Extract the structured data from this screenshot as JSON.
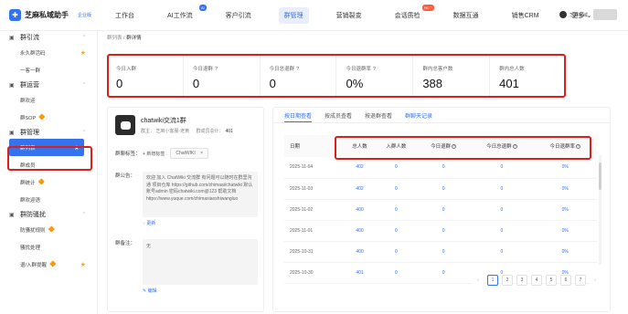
{
  "app": {
    "name": "芝麻私域助手",
    "version": "企业版",
    "logo_glyph": "✚"
  },
  "nav": [
    {
      "label": "工作台"
    },
    {
      "label": "AI工作流",
      "badge": "AI"
    },
    {
      "label": "客户引流"
    },
    {
      "label": "群管理",
      "active": true
    },
    {
      "label": "营销裂变"
    },
    {
      "label": "会话质检",
      "badge": "HOT"
    },
    {
      "label": "数据互通"
    },
    {
      "label": "销售CRM"
    },
    {
      "label": "更多"
    }
  ],
  "user": {
    "name": "芝麻私域"
  },
  "sidebar": {
    "groups": [
      {
        "label": "群引流",
        "icon": "link-icon",
        "items": [
          {
            "label": "永久群活码",
            "star": true
          },
          {
            "label": "一客一群"
          }
        ]
      },
      {
        "label": "群运营",
        "icon": "chat-icon",
        "items": [
          {
            "label": "群欢迎"
          },
          {
            "label": "群SOP",
            "premium": true
          }
        ]
      },
      {
        "label": "群管理",
        "icon": "group-icon",
        "items": [
          {
            "label": "群列表",
            "active": true,
            "star": true
          },
          {
            "label": "群成员"
          },
          {
            "label": "群统计",
            "premium": true
          },
          {
            "label": "群欢迎语"
          }
        ]
      },
      {
        "label": "群防骚扰",
        "icon": "shield-icon",
        "items": [
          {
            "label": "防骚扰规则",
            "premium": true
          },
          {
            "label": "骚扰处理"
          },
          {
            "label": "退/入群提醒",
            "premium": true,
            "star": true
          }
        ]
      }
    ]
  },
  "breadcrumb": {
    "parent": "群列表",
    "sep": "/",
    "current": "群详情"
  },
  "stats": [
    {
      "label": "今日入群",
      "value": "0"
    },
    {
      "label": "今日退群",
      "value": "0",
      "help": true
    },
    {
      "label": "今日总退群",
      "value": "0",
      "help": true
    },
    {
      "label": "今日退群率",
      "value": "0%",
      "help": true
    },
    {
      "label": "群内总客户数",
      "value": "388"
    },
    {
      "label": "群内总人数",
      "value": "401"
    }
  ],
  "group": {
    "name": "chatwiki交流1群",
    "owner_label": "群主：",
    "owner": "芝麻小客服-老黄",
    "member_label": "群成员总计：",
    "member_count": "401",
    "tag_label": "群聊标签：",
    "add_tag": "新增标签",
    "tags": [
      "ChatWIKI"
    ],
    "notice_label": "群公告：",
    "notice": "欢迎 加入 ChatWiki 交流群 有问题可以随时在群里沟通 项目仓库 https://github.com/zhimaai/chatwiki 默认账号admin 密码chatwiki.com@123 帮助文档 https://www.yuque.com/zhimaxiaoshiwangluo",
    "refresh": "更新",
    "remark_label": "群备注：",
    "remark": "无",
    "edit": "编辑"
  },
  "panel": {
    "tabs": [
      {
        "label": "按日期查看",
        "active": true
      },
      {
        "label": "按成员查看"
      },
      {
        "label": "按退群查看"
      },
      {
        "label": "群聊天记录",
        "link": true
      }
    ],
    "columns": [
      {
        "label": "日期"
      },
      {
        "label": "总人数"
      },
      {
        "label": "入群人数"
      },
      {
        "label": "今日退群",
        "help": true
      },
      {
        "label": "今日总退群",
        "help": true
      },
      {
        "label": "今日退群率",
        "help": true
      }
    ],
    "rows": [
      [
        "2025-11-04",
        "402",
        "0",
        "0",
        "0",
        "0%"
      ],
      [
        "2025-11-03",
        "402",
        "0",
        "0",
        "0",
        "0%"
      ],
      [
        "2025-11-02",
        "400",
        "0",
        "0",
        "0",
        "0%"
      ],
      [
        "2025-11-01",
        "400",
        "0",
        "0",
        "0",
        "0%"
      ],
      [
        "2025-10-31",
        "400",
        "0",
        "0",
        "0",
        "0%"
      ],
      [
        "2025-10-30",
        "401",
        "0",
        "0",
        "0",
        "0%"
      ]
    ],
    "pages": [
      "1",
      "2",
      "3",
      "4",
      "5",
      "6",
      "7"
    ],
    "current_page": "1",
    "prev": "‹",
    "next": "›"
  },
  "colors": {
    "primary": "#3472ee",
    "highlight": "#d9201c",
    "star": "#f5a623"
  },
  "icons": {
    "star": "★",
    "premium": "🔶",
    "plus": "+",
    "close": "×",
    "help": "?",
    "refresh": "◌",
    "edit": "✎"
  }
}
